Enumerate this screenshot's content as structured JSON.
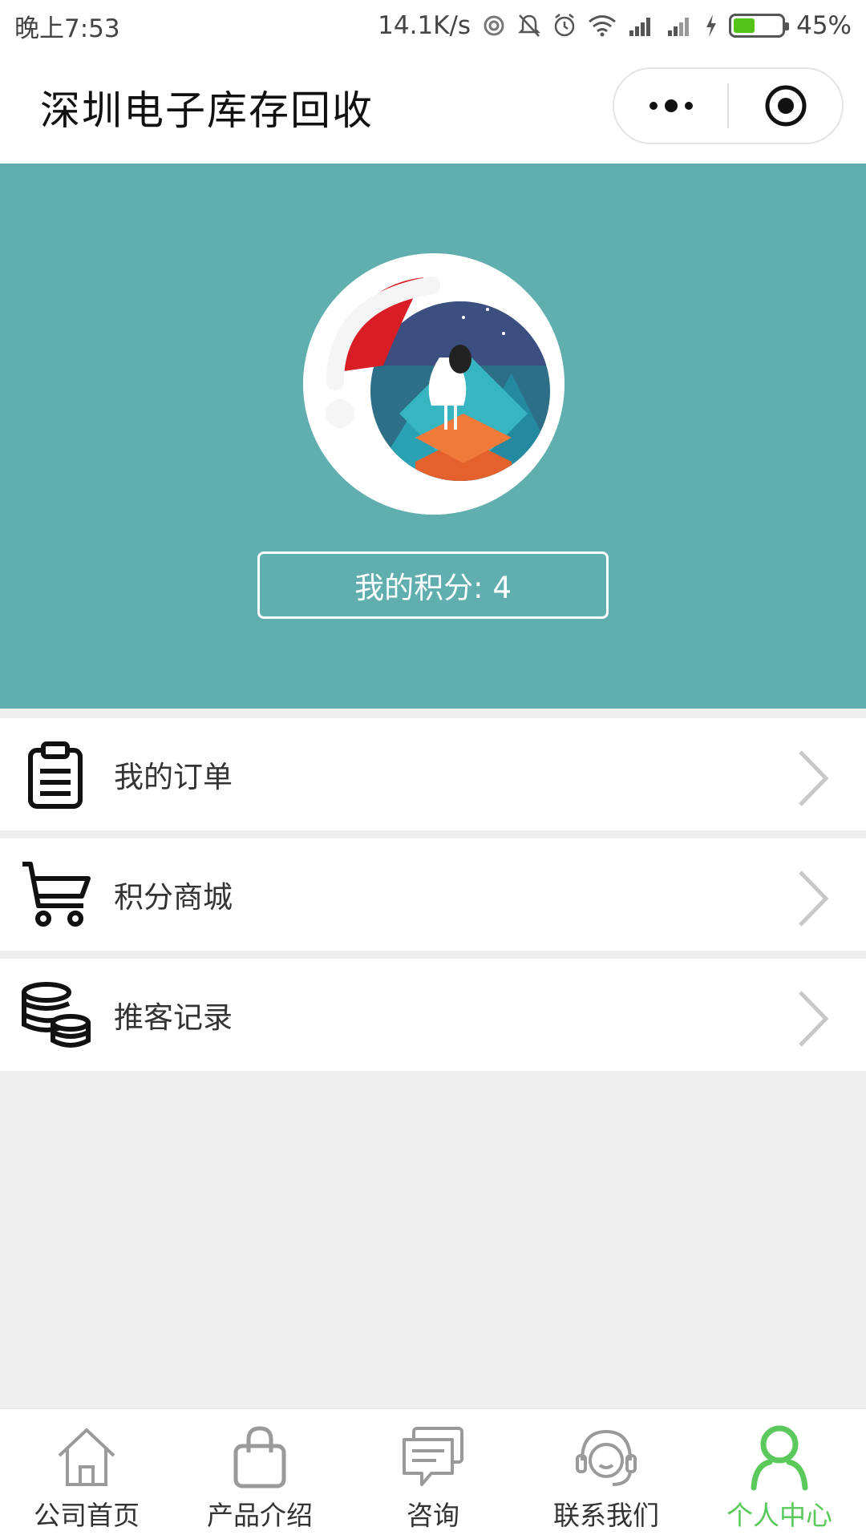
{
  "status_bar": {
    "time": "晚上7:53",
    "network_speed": "14.1K/s",
    "battery_percent": "45%",
    "battery_level": 0.45,
    "icons": [
      "hotspot-icon",
      "mute-icon",
      "alarm-icon",
      "wifi-icon",
      "signal-icon",
      "signal-icon",
      "charging-icon",
      "battery-icon"
    ]
  },
  "title_bar": {
    "title": "深圳电子库存回收",
    "capsule": {
      "more_icon": "more-dots-icon",
      "close_icon": "target-circle-icon"
    }
  },
  "profile": {
    "points_text": "我的积分: 4",
    "background_color": "#61aeae"
  },
  "menu": {
    "items": [
      {
        "label": "我的订单",
        "icon": "clipboard-icon"
      },
      {
        "label": "积分商城",
        "icon": "shopping-cart-icon"
      },
      {
        "label": "推客记录",
        "icon": "coins-stack-icon"
      }
    ]
  },
  "tab_bar": {
    "active_color": "#5bc95b",
    "items": [
      {
        "label": "公司首页",
        "icon": "home-icon",
        "active": false
      },
      {
        "label": "产品介绍",
        "icon": "bag-icon",
        "active": false
      },
      {
        "label": "咨询",
        "icon": "chat-icon",
        "active": false
      },
      {
        "label": "联系我们",
        "icon": "headset-icon",
        "active": false
      },
      {
        "label": "个人中心",
        "icon": "person-icon",
        "active": true
      }
    ]
  }
}
